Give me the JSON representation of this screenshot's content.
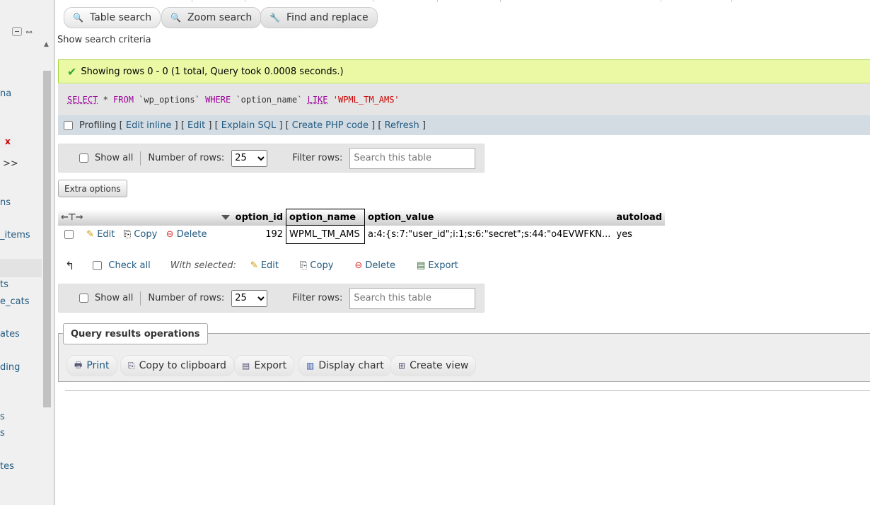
{
  "sidebar": {
    "items": [
      "na",
      "x",
      ">>",
      "ns",
      "_items",
      "ts",
      "e_cats",
      "ates",
      "ding",
      "s",
      "s",
      "tes"
    ]
  },
  "search_tabs": {
    "table_search": "Table search",
    "zoom_search": "Zoom search",
    "find_replace": "Find and replace"
  },
  "show_criteria": "Show search criteria",
  "success": "Showing rows 0 - 0 (1 total, Query took 0.0008 seconds.)",
  "sql": {
    "select": "SELECT",
    "star": " * ",
    "from": "FROM",
    "table": " `wp_options` ",
    "where": "WHERE",
    "column": " `option_name` ",
    "like": "LIKE",
    "value": " 'WPML_TM_AMS'"
  },
  "profiling": {
    "label": "Profiling",
    "edit_inline": "Edit inline",
    "edit": "Edit",
    "explain": "Explain SQL",
    "php": "Create PHP code",
    "refresh": "Refresh"
  },
  "navigation": {
    "show_all": "Show all",
    "rows_label": "Number of rows:",
    "rows_value": "25",
    "filter_label": "Filter rows:",
    "filter_placeholder": "Search this table"
  },
  "extra_options": "Extra options",
  "table": {
    "headers": [
      "option_id",
      "option_name",
      "option_value",
      "autoload"
    ],
    "row_actions": {
      "edit": "Edit",
      "copy": "Copy",
      "delete": "Delete"
    },
    "rows": [
      {
        "option_id": "192",
        "option_name": "WPML_TM_AMS",
        "option_value": "a:4:{s:7:\"user_id\";i:1;s:6:\"secret\";s:44:\"o4EVWFKN...",
        "autoload": "yes"
      }
    ]
  },
  "with_selected": {
    "check_all": "Check all",
    "label": "With selected:",
    "edit": "Edit",
    "copy": "Copy",
    "delete": "Delete",
    "export": "Export"
  },
  "query_ops": {
    "title": "Query results operations",
    "print": "Print",
    "copy_clipboard": "Copy to clipboard",
    "export": "Export",
    "display_chart": "Display chart",
    "create_view": "Create view"
  }
}
